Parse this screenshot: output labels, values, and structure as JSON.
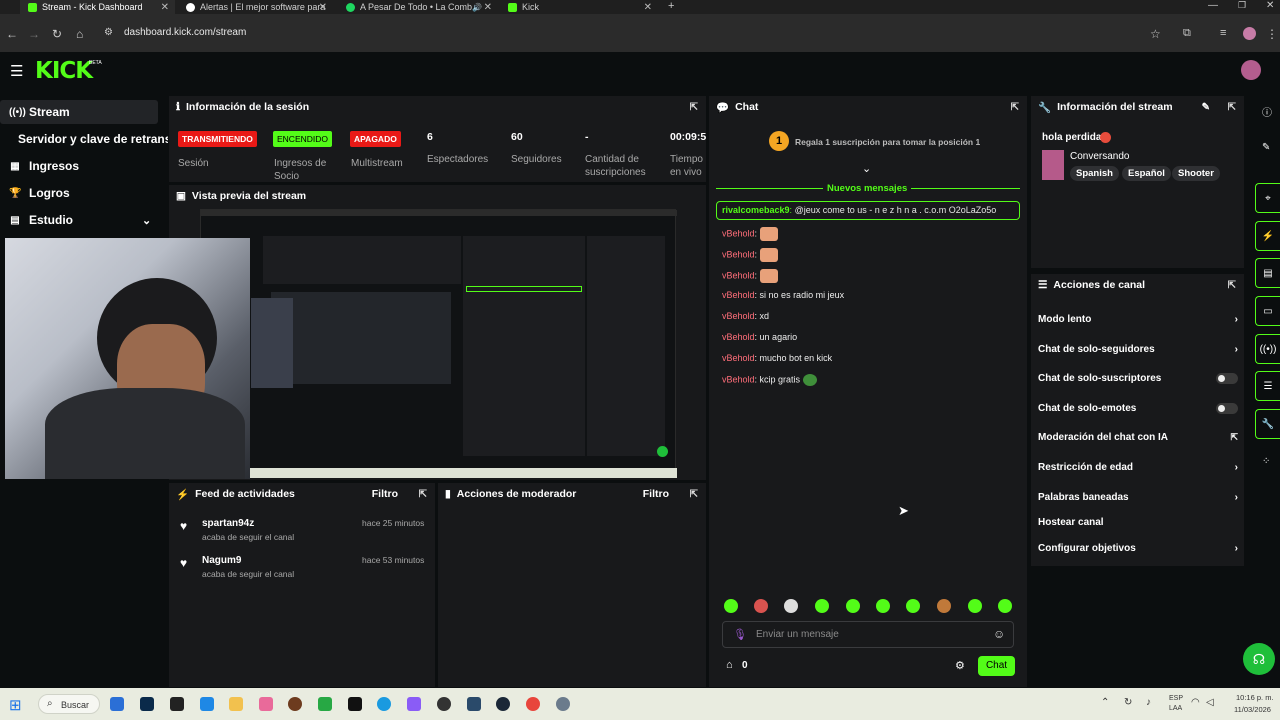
{
  "browser": {
    "tabs": [
      {
        "title": "Stream - Kick Dashboard",
        "active": true
      },
      {
        "title": "Alertas | El mejor software para",
        "active": false
      },
      {
        "title": "A Pesar De Todo • La Comb",
        "active": false
      },
      {
        "title": "Kick",
        "active": false
      }
    ],
    "url": "dashboard.kick.com/stream",
    "new_tab": "+"
  },
  "header": {
    "logo": "KICK",
    "beta": "BETA"
  },
  "sidebar": {
    "items": [
      {
        "label": "Stream",
        "icon": "broadcast-icon"
      },
      {
        "label": "Servidor y clave de retransmisión",
        "icon": ""
      },
      {
        "label": "Ingresos",
        "icon": "grid-icon"
      },
      {
        "label": "Logros",
        "icon": "trophy-icon"
      },
      {
        "label": "Estudio",
        "icon": "studio-icon"
      }
    ]
  },
  "session": {
    "title": "Información de la sesión",
    "stats": [
      {
        "value": "TRANSMITIENDO",
        "label": "Sesión"
      },
      {
        "value": "ENCENDIDO",
        "label": "Ingresos de Socio"
      },
      {
        "value": "APAGADO",
        "label": "Multistream"
      },
      {
        "value": "6",
        "label": "Espectadores"
      },
      {
        "value": "60",
        "label": "Seguidores"
      },
      {
        "value": "-",
        "label": "Cantidad de suscripciones"
      },
      {
        "value": "00:09:5",
        "label": "Tiempo en vivo"
      }
    ]
  },
  "preview": {
    "title": "Vista previa del stream"
  },
  "feed": {
    "title": "Feed de actividades",
    "filter": "Filtro",
    "items": [
      {
        "user": "spartan94z",
        "time": "hace 25 minutos",
        "text": "acaba de seguir el canal"
      },
      {
        "user": "Nagum9",
        "time": "hace 53 minutos",
        "text": "acaba de seguir el canal"
      }
    ]
  },
  "mod": {
    "title": "Acciones de moderador",
    "filter": "Filtro"
  },
  "chat": {
    "title": "Chat",
    "gift_rank": "1",
    "gift_text": "Regala 1 suscripción para tomar la posición 1",
    "new_messages": "Nuevos mensajes",
    "highlight": {
      "user": "rivalcomeback9",
      "text": "@jeux come to us - n e z h n a . c.o.m O2oLaZo5o"
    },
    "messages": [
      {
        "user": "vBehold",
        "text": ""
      },
      {
        "user": "vBehold",
        "text": ""
      },
      {
        "user": "vBehold",
        "text": ""
      },
      {
        "user": "vBehold",
        "text": "si no es radio mi jeux"
      },
      {
        "user": "vBehold",
        "text": "xd"
      },
      {
        "user": "vBehold",
        "text": "un agario"
      },
      {
        "user": "vBehold",
        "text": "mucho bot en kick"
      },
      {
        "user": "vBehold",
        "text": "kcip gratis"
      }
    ],
    "placeholder": "Enviar un mensaje",
    "points": "0",
    "send": "Chat"
  },
  "stream_info": {
    "title": "Información del stream",
    "stream_title": "hola perdida",
    "category": "Conversando",
    "tags": [
      "Spanish",
      "Español",
      "Shooter"
    ]
  },
  "channel_actions": {
    "title": "Acciones de canal",
    "items": [
      {
        "label": "Modo lento",
        "control": "chevron"
      },
      {
        "label": "Chat de solo-seguidores",
        "control": "chevron"
      },
      {
        "label": "Chat de solo-suscriptores",
        "control": "toggle"
      },
      {
        "label": "Chat de solo-emotes",
        "control": "toggle"
      },
      {
        "label": "Moderación del chat con IA",
        "control": "external"
      },
      {
        "label": "Restricción de edad",
        "control": "chevron"
      },
      {
        "label": "Palabras baneadas",
        "control": "chevron"
      },
      {
        "label": "Hostear canal",
        "control": "none"
      },
      {
        "label": "Configurar objetivos",
        "control": "chevron"
      }
    ]
  },
  "taskbar": {
    "search": "Buscar",
    "lang": "ESP",
    "lang2": "LAA",
    "time": "10:16 p. m.",
    "date": "11/03/2026"
  },
  "colors": {
    "accent": "#53fc18",
    "live": "#e91916",
    "bg": "#0b0e0f",
    "panel": "#18191b"
  }
}
